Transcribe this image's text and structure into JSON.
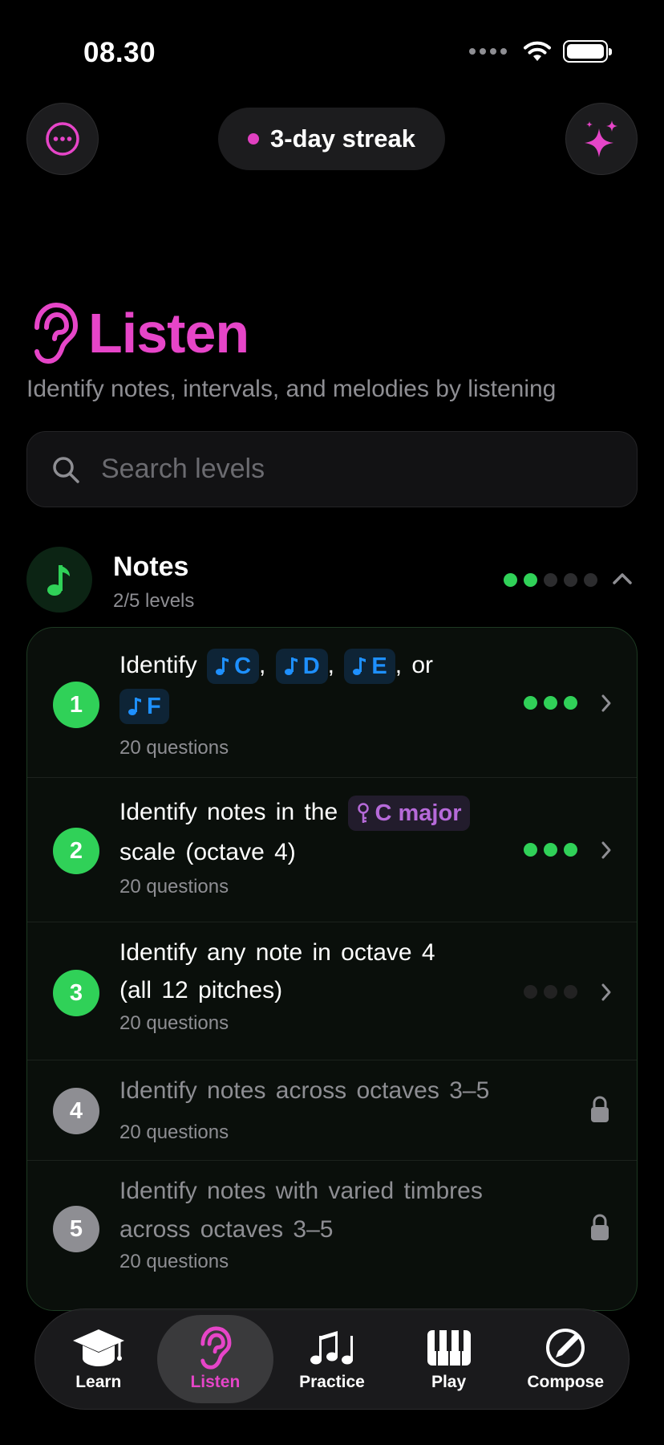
{
  "status_bar": {
    "time": "08.30"
  },
  "header": {
    "streak_label": "3-day streak"
  },
  "page": {
    "title": "Listen",
    "subtitle": "Identify notes, intervals, and melodies by listening"
  },
  "search": {
    "placeholder": "Search levels"
  },
  "section": {
    "title": "Notes",
    "count": "2/5 levels",
    "progress_completed": 2,
    "progress_total": 5
  },
  "levels": [
    {
      "number": "1",
      "prefix": "Identify",
      "chips": [
        "C",
        "D",
        "E",
        "F"
      ],
      "separators": [
        ",",
        ",",
        ", or"
      ],
      "questions": "20 questions",
      "stars": 3
    },
    {
      "number": "2",
      "prefix": "Identify notes in the",
      "key_chip": "C major",
      "suffix": "scale (octave 4)",
      "questions": "20 questions",
      "stars": 3
    },
    {
      "number": "3",
      "line1": "Identify any note in octave 4",
      "line2": "(all 12 pitches)",
      "questions": "20 questions",
      "stars": 0
    },
    {
      "number": "4",
      "line1": "Identify notes across octaves 3–5",
      "questions": "20 questions",
      "locked": true
    },
    {
      "number": "5",
      "line1": "Identify notes with varied timbres",
      "line2": "across octaves 3–5",
      "questions": "20 questions",
      "locked": true
    }
  ],
  "tabs": [
    {
      "label": "Learn",
      "icon": "graduation-cap-icon"
    },
    {
      "label": "Listen",
      "icon": "ear-icon",
      "active": true
    },
    {
      "label": "Practice",
      "icon": "music-notes-icon"
    },
    {
      "label": "Play",
      "icon": "piano-keys-icon"
    },
    {
      "label": "Compose",
      "icon": "pencil-circle-icon"
    }
  ],
  "colors": {
    "accent": "#e645c8",
    "success": "#30d158",
    "note_chip": "#1e90ff",
    "key_chip": "#b66ad9",
    "background": "#000000"
  }
}
